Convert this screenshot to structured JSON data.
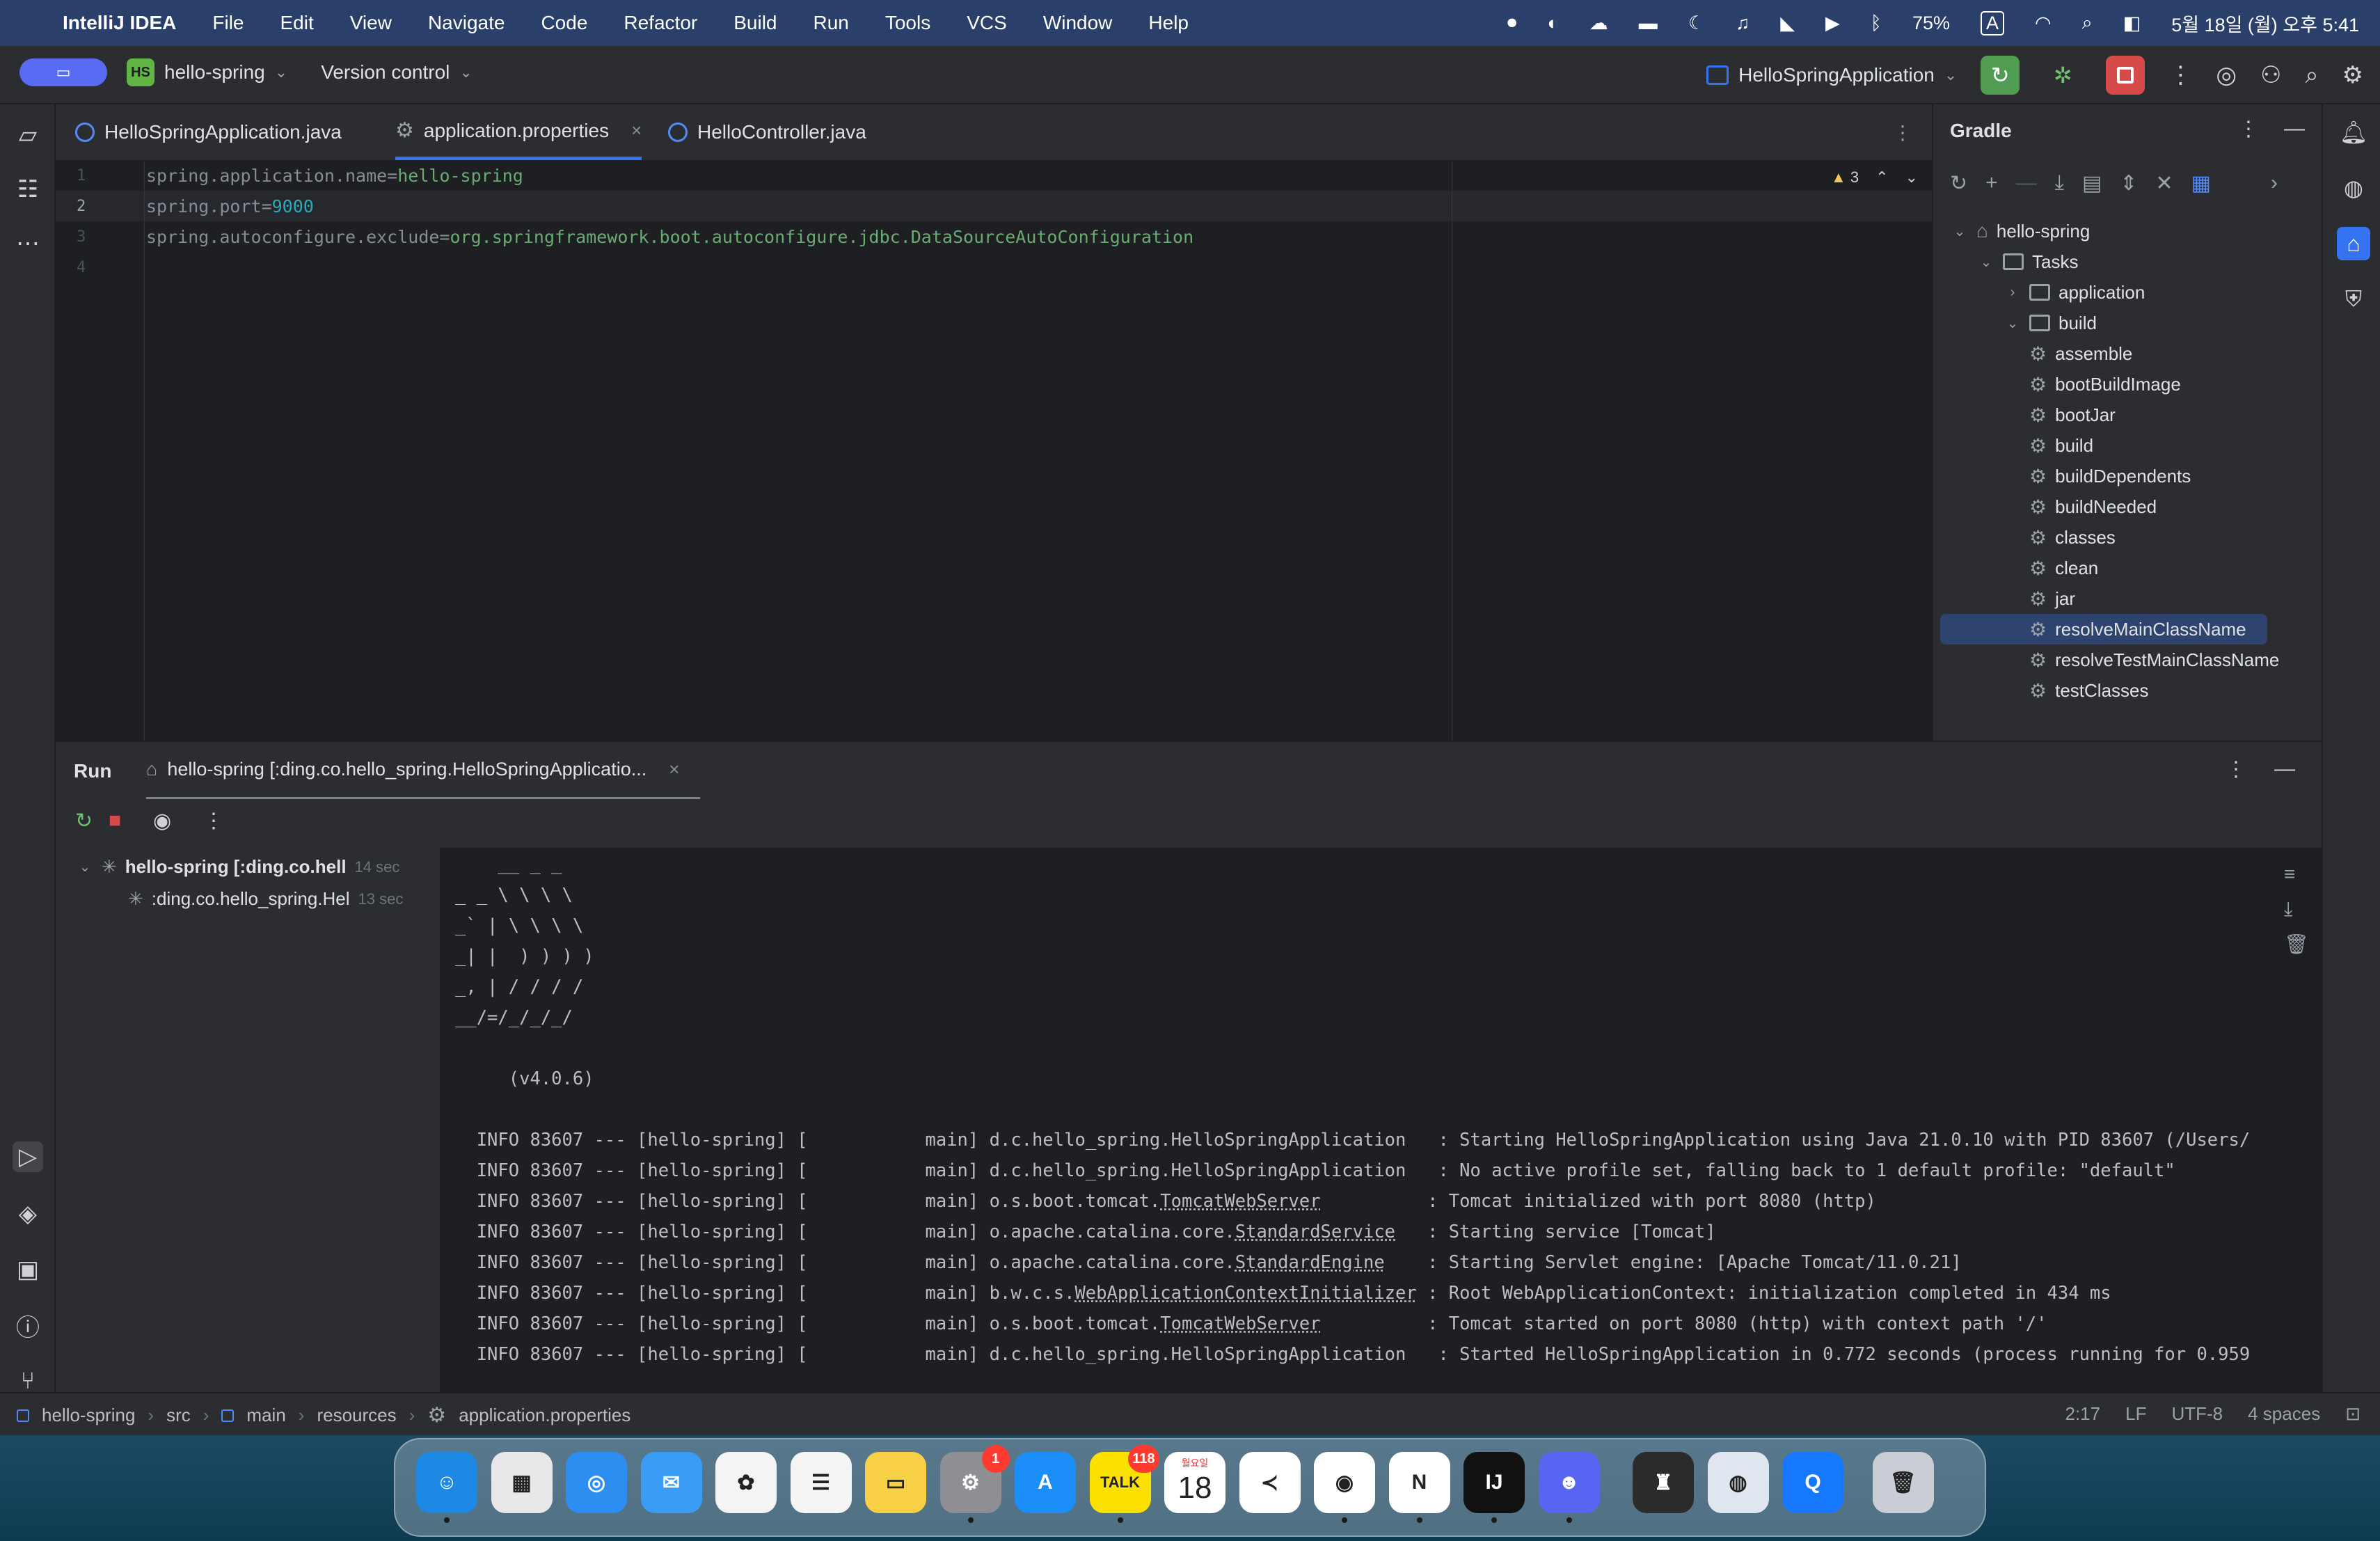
{
  "menubar": {
    "apple_icon": "apple-icon",
    "app_name": "IntelliJ IDEA",
    "items": [
      "File",
      "Edit",
      "View",
      "Navigate",
      "Code",
      "Refactor",
      "Build",
      "Run",
      "Tools",
      "VCS",
      "Window",
      "Help"
    ],
    "battery": "75%",
    "input_mode": "A",
    "datetime": "5월 18일 (월) 오후 5:41"
  },
  "toolbar": {
    "project_badge": "HS",
    "project_name": "hello-spring",
    "vcs_label": "Version control",
    "run_config": "HelloSpringApplication"
  },
  "editor": {
    "tabs": [
      {
        "label": "HelloSpringApplication.java",
        "icon": "java-class-icon"
      },
      {
        "label": "application.properties",
        "icon": "gear-icon",
        "active": true
      },
      {
        "label": "HelloController.java",
        "icon": "java-class-icon"
      }
    ],
    "close_glyph": "×",
    "warnings_count": "3",
    "lines": [
      {
        "n": "1",
        "key": "spring.application.name=",
        "val": "hello-spring"
      },
      {
        "n": "2",
        "key": "spring.port=",
        "val": "9000"
      },
      {
        "n": "3",
        "key": "spring.autoconfigure.exclude=",
        "val": "org.springframework.boot.autoconfigure.jdbc.DataSourceAutoConfiguration"
      },
      {
        "n": "4",
        "key": "",
        "val": ""
      }
    ],
    "cursor_line": "2"
  },
  "gradle": {
    "title": "Gradle",
    "root": "hello-spring",
    "tasks_label": "Tasks",
    "groups": [
      "application",
      "build"
    ],
    "build_tasks": [
      "assemble",
      "bootBuildImage",
      "bootJar",
      "build",
      "buildDependents",
      "buildNeeded",
      "classes",
      "clean",
      "jar",
      "resolveMainClassName",
      "resolveTestMainClassName",
      "testClasses"
    ],
    "selected": "resolveMainClassName"
  },
  "run": {
    "title": "Run",
    "tab_label": "hello-spring [:ding.co.hello_spring.HelloSpringApplicatio...",
    "tree": [
      {
        "label": "hello-spring [:ding.co.hell",
        "duration": "14 sec"
      },
      {
        "label": ":ding.co.hello_spring.Hel",
        "duration": "13 sec"
      }
    ],
    "banner": [
      "    __ _ _",
      "_ _ \\ \\ \\ \\",
      "_` | \\ \\ \\ \\",
      "_| |  ) ) ) )",
      "_, | / / / /",
      "__/=/_/_/_/",
      "",
      "     (v4.0.6)",
      ""
    ],
    "log": [
      {
        "prefix": "  INFO 83607 --- [hello-spring] [           main] ",
        "logger": "d.c.hello_spring.HelloSpringApplication",
        "u": "",
        "pad": "   ",
        "msg": ": Starting HelloSpringApplication using Java 21.0.10 with PID 83607 (/Users/"
      },
      {
        "prefix": "  INFO 83607 --- [hello-spring] [           main] ",
        "logger": "d.c.hello_spring.HelloSpringApplication",
        "u": "",
        "pad": "   ",
        "msg": ": No active profile set, falling back to 1 default profile: \"default\""
      },
      {
        "prefix": "  INFO 83607 --- [hello-spring] [           main] ",
        "logger": "o.s.boot.tomcat.",
        "u": "TomcatWebServer",
        "pad": "          ",
        "msg": ": Tomcat initialized with port 8080 (http)"
      },
      {
        "prefix": "  INFO 83607 --- [hello-spring] [           main] ",
        "logger": "o.apache.catalina.core.",
        "u": "StandardService",
        "pad": "   ",
        "msg": ": Starting service [Tomcat]"
      },
      {
        "prefix": "  INFO 83607 --- [hello-spring] [           main] ",
        "logger": "o.apache.catalina.core.",
        "u": "StandardEngine",
        "pad": "    ",
        "msg": ": Starting Servlet engine: [Apache Tomcat/11.0.21]"
      },
      {
        "prefix": "  INFO 83607 --- [hello-spring] [           main] ",
        "logger": "b.w.c.s.",
        "u": "WebApplicationContextInitializer",
        "pad": " ",
        "msg": ": Root WebApplicationContext: initialization completed in 434 ms"
      },
      {
        "prefix": "  INFO 83607 --- [hello-spring] [           main] ",
        "logger": "o.s.boot.tomcat.",
        "u": "TomcatWebServer",
        "pad": "          ",
        "msg": ": Tomcat started on port 8080 (http) with context path '/'"
      },
      {
        "prefix": "  INFO 83607 --- [hello-spring] [           main] ",
        "logger": "d.c.hello_spring.HelloSpringApplication",
        "u": "",
        "pad": "   ",
        "msg": ": Started HelloSpringApplication in 0.772 seconds (process running for 0.959"
      }
    ]
  },
  "statusbar": {
    "crumbs": [
      "hello-spring",
      "src",
      "main",
      "resources",
      "application.properties"
    ],
    "position": "2:17",
    "line_sep": "LF",
    "encoding": "UTF-8",
    "indent": "4 spaces"
  },
  "dock": {
    "apps": [
      {
        "name": "finder",
        "color": "#1e88e5",
        "glyph": "☺"
      },
      {
        "name": "launchpad",
        "color": "#e8e8ea",
        "glyph": "▦"
      },
      {
        "name": "safari",
        "color": "#2c8ef0",
        "glyph": "◎"
      },
      {
        "name": "mail",
        "color": "#3a9cf5",
        "glyph": "✉"
      },
      {
        "name": "photos",
        "color": "#f4f4f4",
        "glyph": "✿"
      },
      {
        "name": "reminders",
        "color": "#f4f4f4",
        "glyph": "☰"
      },
      {
        "name": "notes",
        "color": "#f7d046",
        "glyph": "▭"
      },
      {
        "name": "system-settings",
        "color": "#8e8e93",
        "glyph": "⚙",
        "badge": "1"
      },
      {
        "name": "app-store",
        "color": "#1c8ef9",
        "glyph": "A"
      },
      {
        "name": "kakaotalk",
        "color": "#fae100",
        "glyph": "TALK",
        "badge": "118"
      },
      {
        "name": "calendar",
        "color": "#ffffff",
        "glyph": "18",
        "sub": "월요일"
      },
      {
        "name": "vscode",
        "color": "#ffffff",
        "glyph": "≺"
      },
      {
        "name": "chrome",
        "color": "#ffffff",
        "glyph": "◉"
      },
      {
        "name": "notion",
        "color": "#ffffff",
        "glyph": "N"
      },
      {
        "name": "intellij",
        "color": "#111111",
        "glyph": "IJ"
      },
      {
        "name": "discord",
        "color": "#5865f2",
        "glyph": "☻"
      },
      {
        "name": "keka",
        "color": "#2b2b2b",
        "glyph": "♜"
      },
      {
        "name": "cyberduck",
        "color": "#dfe6ef",
        "glyph": "◍"
      },
      {
        "name": "qq",
        "color": "#1677ff",
        "glyph": "Q"
      },
      {
        "name": "trash",
        "color": "#c9ced6",
        "glyph": "🗑"
      }
    ]
  }
}
